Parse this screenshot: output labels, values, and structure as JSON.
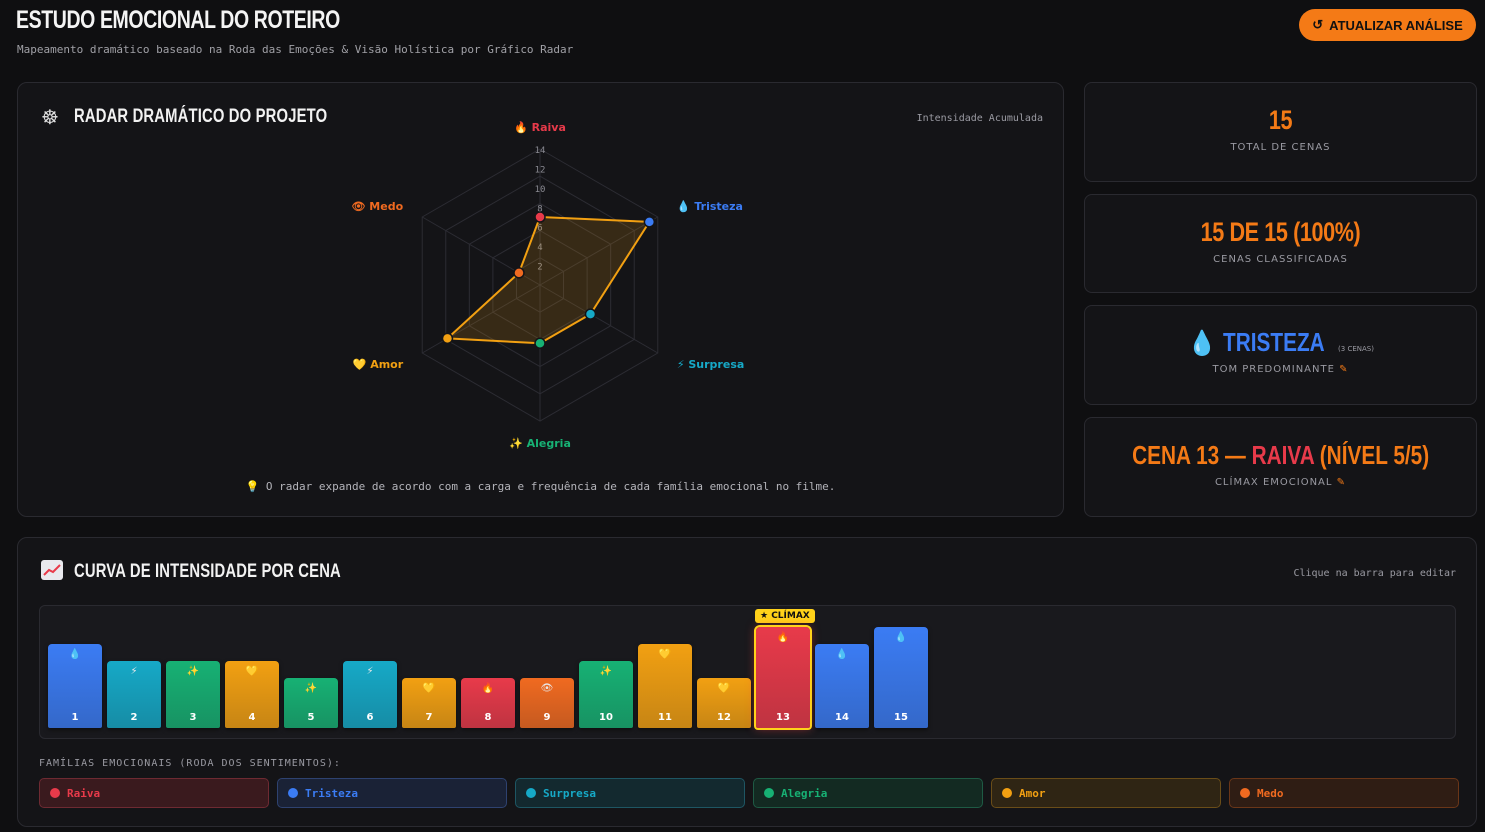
{
  "header": {
    "title": "ESTUDO EMOCIONAL DO ROTEIRO",
    "subtitle": "Mapeamento dramático baseado na Roda das Emoções & Visão Holística por Gráfico Radar",
    "update_icon": "refresh-icon",
    "update_label": "ATUALIZAR ANÁLISE"
  },
  "radar": {
    "icon": "wheel-icon",
    "title": "RADAR DRAMÁTICO DO PROJETO",
    "note": "Intensidade Acumulada",
    "footer": "💡 O radar expande de acordo com a carga e frequência de cada família emocional no filme.",
    "chart_data": {
      "type": "radar",
      "axes": [
        {
          "label": "Raiva",
          "emoji": "🔥",
          "value": 7,
          "color": "#e83a4a"
        },
        {
          "label": "Tristeza",
          "emoji": "💧",
          "value": 13,
          "color": "#3b7cf4"
        },
        {
          "label": "Surpresa",
          "emoji": "⚡",
          "value": 6,
          "color": "#16a9c7"
        },
        {
          "label": "Alegria",
          "emoji": "✨",
          "value": 6,
          "color": "#17b174"
        },
        {
          "label": "Amor",
          "emoji": "💛",
          "value": 11,
          "color": "#f2a012"
        },
        {
          "label": "Medo",
          "emoji": "👁",
          "value": 2.5,
          "color": "#f06a20"
        }
      ],
      "ticks": [
        "2",
        "4",
        "6",
        "8",
        "10",
        "12",
        "14"
      ],
      "rmax": 14,
      "line_color": "#f2a012"
    }
  },
  "stats": [
    {
      "value": "15",
      "label": "TOTAL DE CENAS"
    },
    {
      "value": "15 DE 15 (100%)",
      "label": "CENAS CLASSIFICADAS"
    },
    {
      "emoji": "💧",
      "value": "TRISTEZA",
      "sub": "(3 CENAS)",
      "label": "TOM PREDOMINANTE",
      "edit_icon": "pencil-icon",
      "value_color": "#3b7cf4"
    },
    {
      "prefix": "CENA 13 — ",
      "value": "RAIVA",
      "suffix": " (NÍVEL 5/5)",
      "label": "CLÍMAX EMOCIONAL",
      "edit_icon": "pencil-icon",
      "value_color": "#e83a4a"
    }
  ],
  "curve": {
    "icon": "chart-up-icon",
    "title": "CURVA DE INTENSIDADE POR CENA",
    "note": "Clique na barra para editar",
    "climax_tag": "★ CLÍMAX",
    "climax_scene": 13,
    "chart_data": {
      "type": "bar",
      "categories": [
        "1",
        "2",
        "3",
        "4",
        "5",
        "6",
        "7",
        "8",
        "9",
        "10",
        "11",
        "12",
        "13",
        "14",
        "15"
      ],
      "values": [
        4,
        3,
        3,
        3,
        2,
        3,
        2,
        2,
        2,
        3,
        4,
        2,
        5,
        4,
        5
      ],
      "emotions": [
        "Tristeza",
        "Surpresa",
        "Alegria",
        "Amor",
        "Alegria",
        "Surpresa",
        "Amor",
        "Raiva",
        "Medo",
        "Alegria",
        "Amor",
        "Amor",
        "Raiva",
        "Tristeza",
        "Tristeza"
      ],
      "ylim": [
        0,
        5
      ]
    },
    "families_label": "FAMÍLIAS EMOCIONAIS (RODA DOS SENTIMENTOS):",
    "families": [
      {
        "name": "Raiva",
        "emoji": "🔥",
        "color": "#e83a4a",
        "bg": "#3a1a1e",
        "border": "#6e2a32"
      },
      {
        "name": "Tristeza",
        "emoji": "💧",
        "color": "#3b7cf4",
        "bg": "#1a2236",
        "border": "#2e4270"
      },
      {
        "name": "Surpresa",
        "emoji": "⚡",
        "color": "#16a9c7",
        "bg": "#13292f",
        "border": "#1e5663"
      },
      {
        "name": "Alegria",
        "emoji": "✨",
        "color": "#17b174",
        "bg": "#132a22",
        "border": "#1e5a44"
      },
      {
        "name": "Amor",
        "emoji": "💛",
        "color": "#f2a012",
        "bg": "#2f2514",
        "border": "#6a4d18"
      },
      {
        "name": "Medo",
        "emoji": "👁",
        "color": "#f06a20",
        "bg": "#2f1d14",
        "border": "#6a3618"
      }
    ]
  }
}
